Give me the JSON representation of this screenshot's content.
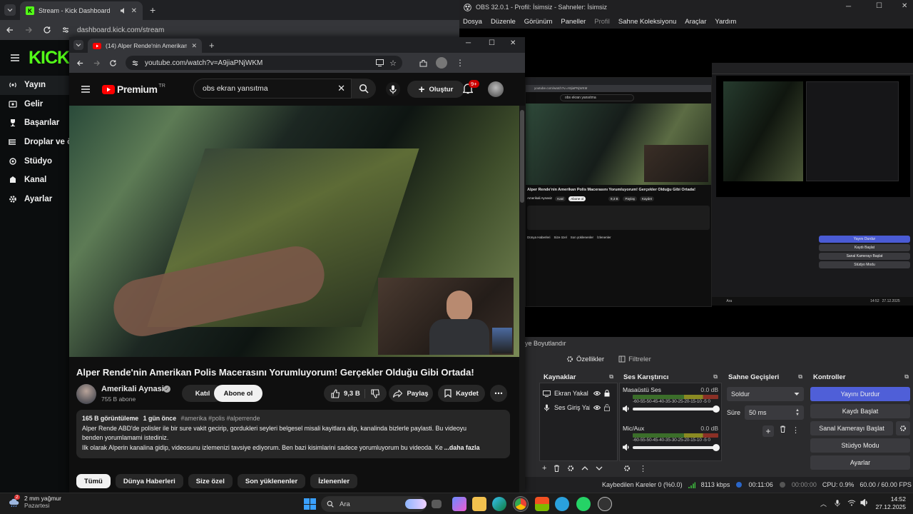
{
  "kick_browser": {
    "tab_title": "Stream - Kick Dashboard",
    "url": "dashboard.kick.com/stream",
    "logo": "KICK",
    "sidebar": [
      {
        "label": "Yayın",
        "icon": "broadcast-icon"
      },
      {
        "label": "Gelir",
        "icon": "dollar-icon"
      },
      {
        "label": "Başarılar",
        "icon": "trophy-icon"
      },
      {
        "label": "Droplar ve ö",
        "icon": "drops-icon"
      },
      {
        "label": "Stüdyo",
        "icon": "studio-icon"
      },
      {
        "label": "Kanal",
        "icon": "channel-icon"
      },
      {
        "label": "Ayarlar",
        "icon": "gear-icon"
      }
    ]
  },
  "obs": {
    "title": "OBS 32.0.1 - Profil: İsimsiz - Sahneler: İsimsiz",
    "menu": [
      "Dosya",
      "Düzenle",
      "Görünüm",
      "Paneller",
      "Profil",
      "Sahne Koleksiyonu",
      "Araçlar",
      "Yardım"
    ],
    "preview_side_label": "ye Boyutlandır",
    "props_tab": "Özellikler",
    "filters_tab": "Filtreler",
    "sources_title": "Kaynaklar",
    "sources": [
      {
        "name": "Ekran Yakal"
      },
      {
        "name": "Ses Giriş Yal"
      }
    ],
    "mixer_title": "Ses Karıştırıcı",
    "mixer": [
      {
        "name": "Masaüstü Ses",
        "db": "0.0 dB",
        "level": 0.62
      },
      {
        "name": "Mic/Aux",
        "db": "0.0 dB",
        "level": 0.55
      }
    ],
    "meter_ticks": "-60-55-50-45-40-35-30-25-20-15-10 -5  0",
    "transitions_title": "Sahne Geçişleri",
    "transition_type": "Soldur",
    "duration_label": "Süre",
    "duration_value": "50 ms",
    "controls_title": "Kontroller",
    "controls": [
      "Yayını Durdur",
      "Kaydı Başlat",
      "Sanal Kamerayı Başlat",
      "Stüdyo Modu",
      "Ayarlar"
    ],
    "status": {
      "dropped": "Kaybedilen Kareler 0 (%0.0)",
      "kbps": "8113 kbps",
      "stream_time": "00:11:06",
      "rec_time": "00:00:00",
      "cpu": "CPU: 0.9%",
      "fps": "60.00 / 60.00 FPS"
    },
    "mini": {
      "url": "youtube.com/watch?v=A9jiaPNjWKM",
      "search": "obs ekran yansıtma",
      "title": "Alper Rende'nin Amerikan Polis Macerasını Yorumluyorum! Gerçekler Olduğu Gibi Ortada!",
      "channel": "Amerikali Aynasiz",
      "likes": "9,3 B",
      "share": "Paylaş",
      "save": "Kaydet",
      "subscribe": "Abone ol",
      "join": "Katıl",
      "chips": [
        "Dünya Haberleri",
        "Size özel",
        "Son yüklenenler",
        "İzlenenler"
      ],
      "controls": [
        "Yayını Durdur",
        "Kaydı Başlat",
        "Sanal Kamerayı Başlat",
        "Stüdyo Modu",
        "Ayarlar"
      ],
      "search_label": "Ara",
      "time": "14:52",
      "date": "27.12.2025"
    }
  },
  "youtube": {
    "tab_title": "(14) Alper Rende'nin Amerikan",
    "url": "youtube.com/watch?v=A9jiaPNjWKM",
    "logo": "Premium",
    "logo_sup": "TR",
    "search_text": "obs ekran yansıtma",
    "create_label": "Oluştur",
    "notif_count": "9+",
    "video_title": "Alper Rende'nin Amerikan Polis Macerasını Yorumluyorum! Gerçekler Olduğu Gibi Ortada!",
    "channel_name": "Amerikali Aynasiz",
    "subscribers": "755 B abone",
    "join_label": "Katıl",
    "subscribe_label": "Abone ol",
    "likes": "9,3 B",
    "share_label": "Paylaş",
    "save_label": "Kaydet",
    "views": "165 B görüntüleme",
    "published": "1 gün önce",
    "hashtags": "#amerika #polis #alperrende",
    "description_1": "Alper Rende ABD'de polisler ile bir sure vakit gecirip, gordukleri seyleri belgesel misali kayitlara alip, kanalinda bizlerle paylasti. Bu videoyu",
    "description_2": "benden yorumlamami istediniz.",
    "description_3": "Ilk olarak Alperin kanalina gidip, videosunu izlemenizi tavsiye ediyorum. Ben bazi kisimlarini sadece yorumluyorum bu videoda. Ke",
    "more_label": "...daha fazla",
    "chips": [
      "Tümü",
      "Dünya Haberleri",
      "Size özel",
      "Son yüklenenler",
      "İzlenenler"
    ]
  },
  "taskbar": {
    "weather_temp": "2 mm yağmur",
    "weather_day": "Pazartesi",
    "weather_badge": "2",
    "search_placeholder": "Ara",
    "time": "14:52",
    "date": "27.12.2025"
  }
}
